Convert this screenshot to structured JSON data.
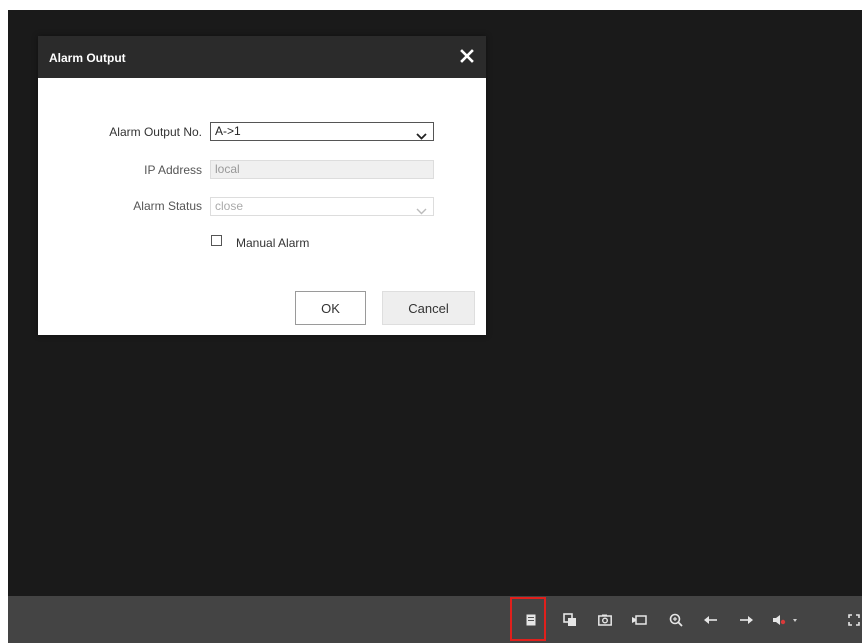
{
  "dialog": {
    "title": "Alarm Output",
    "fields": {
      "alarm_output_no": {
        "label": "Alarm Output No.",
        "value": "A->1"
      },
      "ip_address": {
        "label": "IP Address",
        "value": "local"
      },
      "alarm_status": {
        "label": "Alarm Status",
        "value": "close"
      }
    },
    "manual_alarm": {
      "label": "Manual Alarm",
      "checked": false
    },
    "ok_label": "OK",
    "cancel_label": "Cancel"
  },
  "toolbar": {
    "icons": [
      "alarm-output-icon",
      "capture-switch-icon",
      "snapshot-icon",
      "record-icon",
      "zoom-icon",
      "previous-icon",
      "next-icon",
      "audio-icon",
      "fullscreen-icon"
    ]
  },
  "colors": {
    "video_bg": "#1a1a1a",
    "toolbar_bg": "#444444",
    "dialog_header_bg": "#2b2b2b",
    "highlight": "#e0201c"
  }
}
